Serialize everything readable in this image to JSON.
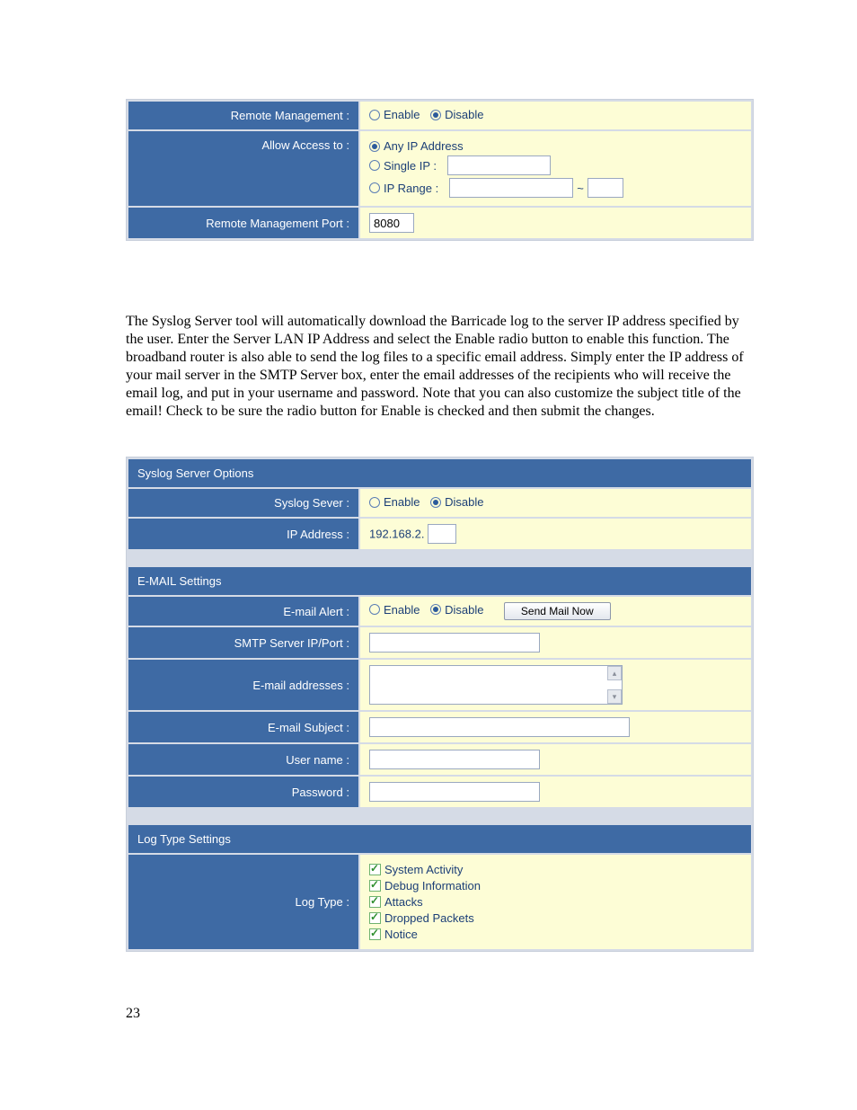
{
  "remote": {
    "label_management": "Remote Management :",
    "enable": "Enable",
    "disable": "Disable",
    "label_allow": "Allow Access to :",
    "opt_any": "Any IP Address",
    "opt_single": "Single IP :",
    "opt_range": "IP Range :",
    "range_sep": "~",
    "label_port": "Remote Management Port :",
    "port_value": "8080"
  },
  "bodytext": "The Syslog Server tool will automatically download the Barricade log to the server IP address specified by the user. Enter the Server LAN IP Address and select the Enable radio button to enable this function. The broadband router is also able to send the log files to a specific email address. Simply enter the IP address of your mail server in the SMTP Server box, enter the email addresses of the recipients who will receive the email log, and put in your username and password. Note that you can also customize the subject title of the email! Check to be sure the radio button for Enable is checked and then submit the changes.",
  "syslog": {
    "header": "Syslog Server Options",
    "label_server": "Syslog Sever :",
    "enable": "Enable",
    "disable": "Disable",
    "label_ip": "IP Address :",
    "ip_prefix": "192.168.2."
  },
  "email": {
    "header": "E-MAIL Settings",
    "label_alert": "E-mail Alert :",
    "enable": "Enable",
    "disable": "Disable",
    "btn_send": "Send Mail Now",
    "label_smtp": "SMTP Server IP/Port :",
    "label_addresses": "E-mail addresses :",
    "label_subject": "E-mail Subject :",
    "label_user": "User name :",
    "label_pass": "Password :"
  },
  "logtype": {
    "header": "Log Type Settings",
    "label": "Log Type :",
    "items": {
      "0": "System Activity",
      "1": "Debug Information",
      "2": "Attacks",
      "3": "Dropped Packets",
      "4": "Notice"
    }
  },
  "pagenum": "23"
}
